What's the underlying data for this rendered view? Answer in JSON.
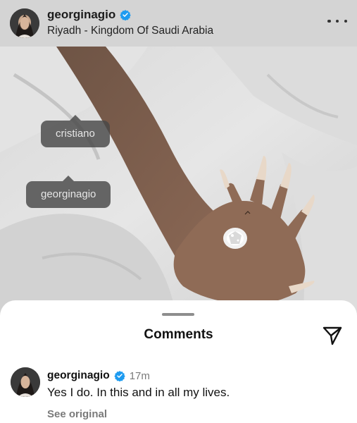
{
  "post": {
    "username": "georginagio",
    "location": "Riyadh - Kingdom Of Saudi Arabia",
    "more_icon": "more-horizontal-icon",
    "verified_icon": "verified-badge-icon"
  },
  "tags": [
    {
      "label": "cristiano"
    },
    {
      "label": "georginagio"
    }
  ],
  "comments_sheet": {
    "title": "Comments",
    "share_icon": "send-icon",
    "comments": [
      {
        "username": "georginagio",
        "time": "17m",
        "text": "Yes I do. In this and in all my lives.",
        "see_original": "See original"
      }
    ]
  },
  "colors": {
    "verified": "#1d9bf0",
    "sheet_background": "#ffffff",
    "tag_background": "#484848"
  }
}
